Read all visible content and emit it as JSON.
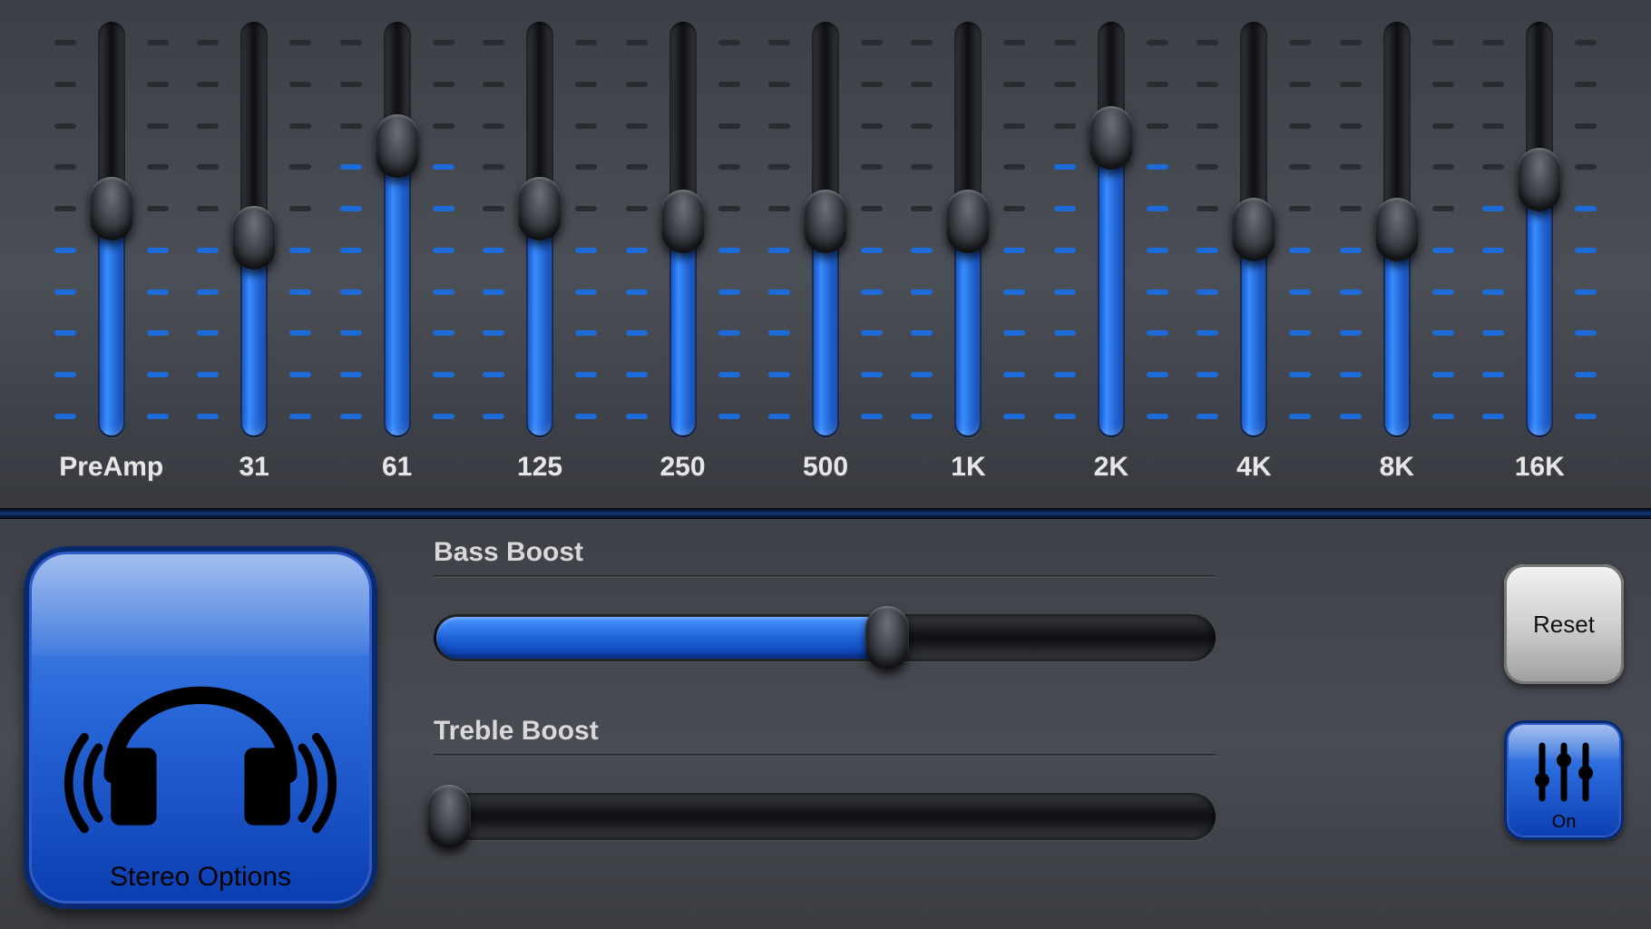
{
  "colors": {
    "accent": "#1c5fd6",
    "accent_light": "#4a96ff",
    "panel_bg": "#44474e",
    "dark": "#111216",
    "tick_lit": "#1d6ad9",
    "tick_off": "#2a2c32"
  },
  "equalizer": {
    "tick_count": 10,
    "bands": [
      {
        "id": "preamp",
        "label": "PreAmp",
        "value": 55
      },
      {
        "id": "b31",
        "label": "31",
        "value": 48
      },
      {
        "id": "b61",
        "label": "61",
        "value": 70
      },
      {
        "id": "b125",
        "label": "125",
        "value": 55
      },
      {
        "id": "b250",
        "label": "250",
        "value": 52
      },
      {
        "id": "b500",
        "label": "500",
        "value": 52
      },
      {
        "id": "b1k",
        "label": "1K",
        "value": 52
      },
      {
        "id": "b2k",
        "label": "2K",
        "value": 72
      },
      {
        "id": "b4k",
        "label": "4K",
        "value": 50
      },
      {
        "id": "b8k",
        "label": "8K",
        "value": 50
      },
      {
        "id": "b16k",
        "label": "16K",
        "value": 62
      }
    ]
  },
  "boosts": {
    "bass": {
      "label": "Bass Boost",
      "value": 58
    },
    "treble": {
      "label": "Treble Boost",
      "value": 2
    }
  },
  "buttons": {
    "stereo_label": "Stereo Options",
    "reset_label": "Reset",
    "on_label": "On"
  },
  "icons": {
    "headphones": "headphones-icon",
    "sliders": "sliders-icon"
  }
}
